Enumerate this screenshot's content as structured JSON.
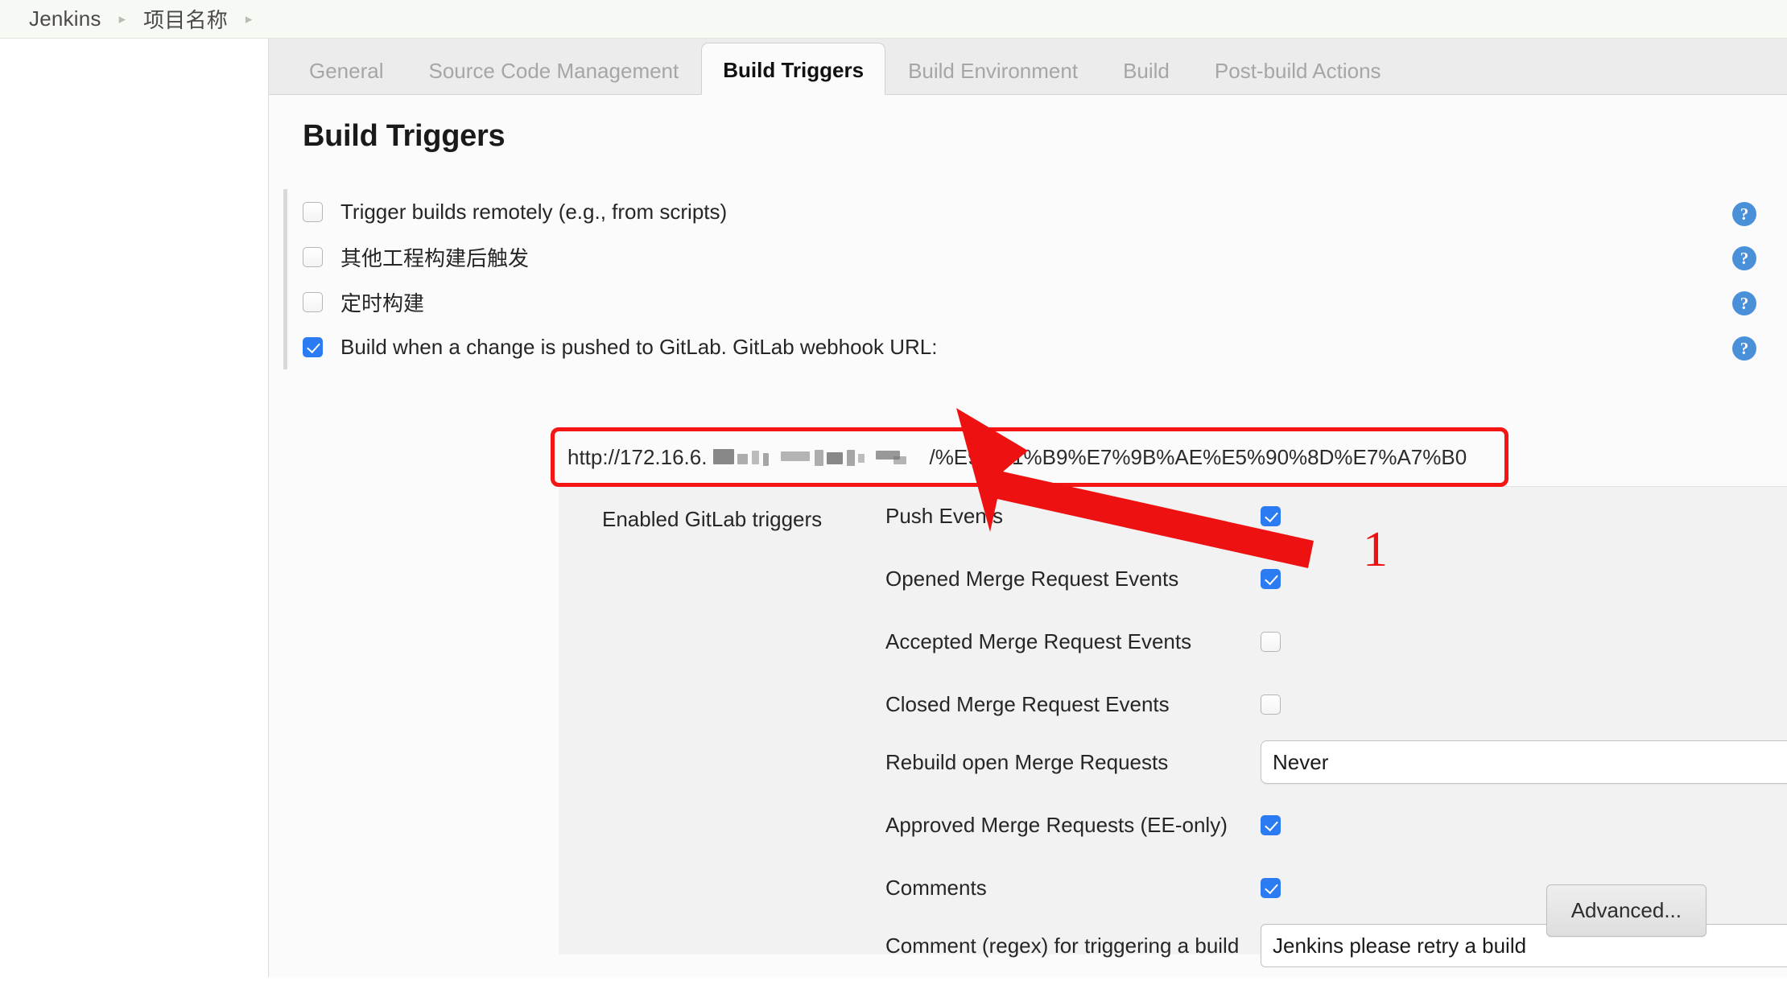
{
  "breadcrumb": {
    "items": [
      {
        "label": "Jenkins"
      },
      {
        "label": "项目名称"
      }
    ],
    "separator": "›"
  },
  "tabs": [
    {
      "label": "General",
      "active": false
    },
    {
      "label": "Source Code Management",
      "active": false
    },
    {
      "label": "Build Triggers",
      "active": true
    },
    {
      "label": "Build Environment",
      "active": false
    },
    {
      "label": "Build",
      "active": false
    },
    {
      "label": "Post-build Actions",
      "active": false
    }
  ],
  "page": {
    "title": "Build Triggers"
  },
  "triggers": [
    {
      "label": "Trigger builds remotely (e.g., from scripts)",
      "checked": false,
      "help": "?"
    },
    {
      "label": "其他工程构建后触发",
      "checked": false,
      "help": "?"
    },
    {
      "label": "定时构建",
      "checked": false,
      "help": "?"
    },
    {
      "label": "Build when a change is pushed to GitLab. GitLab webhook URL:",
      "checked": true,
      "help": "?"
    }
  ],
  "webhook": {
    "url_prefix": "http://172.16.6.",
    "url_suffix": "/%E9%A1%B9%E7%9B%AE%E5%90%8D%E7%A7%B0",
    "redacted": true,
    "highlight_color": "#f51515"
  },
  "gitlab": {
    "section_label": "Enabled GitLab triggers",
    "rows": [
      {
        "label": "Push Events",
        "type": "checkbox",
        "checked": true
      },
      {
        "label": "Opened Merge Request Events",
        "type": "checkbox",
        "checked": true
      },
      {
        "label": "Accepted Merge Request Events",
        "type": "checkbox",
        "checked": false
      },
      {
        "label": "Closed Merge Request Events",
        "type": "checkbox",
        "checked": false
      },
      {
        "label": "Rebuild open Merge Requests",
        "type": "select",
        "value": "Never"
      },
      {
        "label": "Approved Merge Requests (EE-only)",
        "type": "checkbox",
        "checked": true
      },
      {
        "label": "Comments",
        "type": "checkbox",
        "checked": true
      },
      {
        "label": "Comment (regex) for triggering a build",
        "type": "text",
        "value": "Jenkins please retry a build",
        "help": "?"
      }
    ],
    "advanced_label": "Advanced..."
  },
  "annotation": {
    "number": "1",
    "color": "#ee1111"
  }
}
